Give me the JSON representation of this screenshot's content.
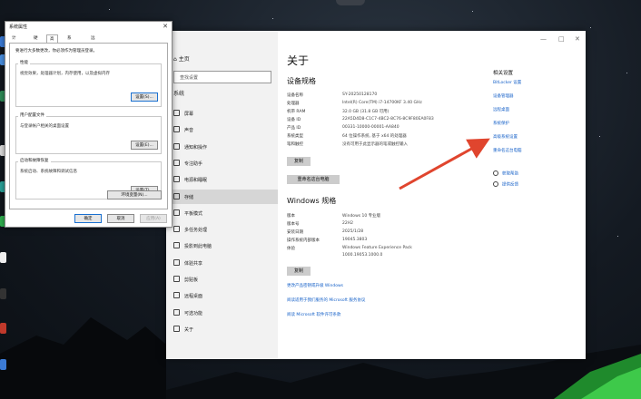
{
  "settings": {
    "nav": {
      "home": "主页",
      "search_placeholder": "查找设置",
      "section": "系统",
      "items": [
        {
          "label": "屏幕"
        },
        {
          "label": "声音"
        },
        {
          "label": "通知和操作"
        },
        {
          "label": "专注助手"
        },
        {
          "label": "电源和睡眠"
        },
        {
          "label": "存储"
        },
        {
          "label": "平板模式"
        },
        {
          "label": "多任务处理"
        },
        {
          "label": "投影到此电脑"
        },
        {
          "label": "体验共享"
        },
        {
          "label": "剪贴板"
        },
        {
          "label": "远程桌面"
        },
        {
          "label": "可选功能"
        },
        {
          "label": "关于"
        }
      ]
    },
    "title": "关于",
    "device_specs": {
      "heading": "设备规格",
      "rows": [
        {
          "key": "设备名称",
          "value": "SY-20250128170"
        },
        {
          "key": "处理器",
          "value": "Intel(R) Core(TM) i7-14700KF   3.40 GHz"
        },
        {
          "key": "机带 RAM",
          "value": "32.0 GB (31.8 GB 可用)"
        },
        {
          "key": "设备 ID",
          "value": "22A5D4D8-C1C7-4BC2-8C76-8C9F80EA0F83"
        },
        {
          "key": "产品 ID",
          "value": "00331-10000-00001-AA840"
        },
        {
          "key": "系统类型",
          "value": "64 位操作系统, 基于 x64 的处理器"
        },
        {
          "key": "笔和触控",
          "value": "没有可用于此显示器的笔或触控输入"
        }
      ],
      "copy_button": "复制",
      "rename_button": "重命名这台电脑"
    },
    "windows_specs": {
      "heading": "Windows 规格",
      "rows": [
        {
          "key": "版本",
          "value": "Windows 10 专业版"
        },
        {
          "key": "版本号",
          "value": "22H2"
        },
        {
          "key": "安装日期",
          "value": "2025/1/28"
        },
        {
          "key": "操作系统内部版本",
          "value": "19045.3803"
        },
        {
          "key": "体验",
          "value": "Windows Feature Experience Pack"
        },
        {
          "key": "",
          "value": "1000.19053.1000.0"
        }
      ],
      "copy_button": "复制",
      "links": [
        "更改产品密钥或升级 Windows",
        "阅读适用于我们服务的 Microsoft 服务协议",
        "阅读 Microsoft 软件许可条款"
      ]
    },
    "related": {
      "title": "相关设置",
      "links": [
        "BitLocker 设置",
        "设备管理器",
        "远程桌面",
        "系统保护",
        "高级系统设置",
        "重命名这台电脑"
      ],
      "help": [
        "获取帮助",
        "提供反馈"
      ]
    },
    "controls": {
      "minimize": "—",
      "maximize": "□",
      "close": "✕"
    }
  },
  "dialog": {
    "title": "系统属性",
    "close": "✕",
    "tabs": [
      "计算机名",
      "硬件",
      "高级",
      "系统保护",
      "远程"
    ],
    "active_tab": "高级",
    "note": "要进行大多数更改，你必须作为管理员登录。",
    "groups": [
      {
        "title": "性能",
        "desc": "视觉效果，处理器计划，内存使用，以及虚拟内存",
        "button": "设置(S)..."
      },
      {
        "title": "用户配置文件",
        "desc": "与登录帐户相关的桌面设置",
        "button": "设置(E)..."
      },
      {
        "title": "启动和故障恢复",
        "desc": "系统启动、系统故障和调试信息",
        "button": "设置(T)..."
      }
    ],
    "env_button": "环境变量(N)...",
    "ok": "确定",
    "cancel": "取消",
    "apply": "应用(A)"
  },
  "colors": {
    "accent": "#1560c8",
    "arrow": "#e0452e"
  }
}
